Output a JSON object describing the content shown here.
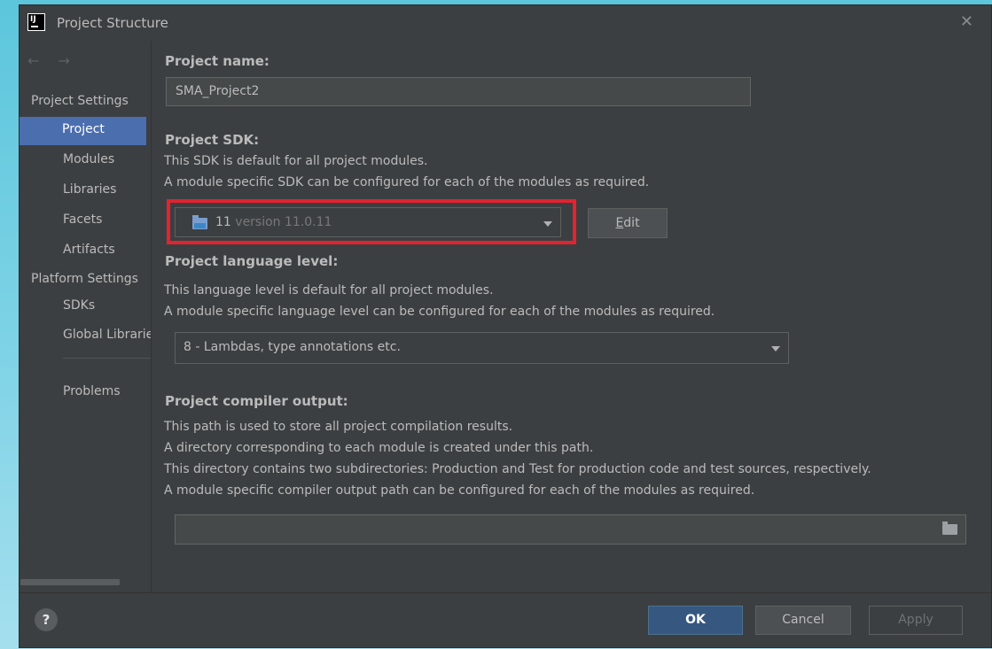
{
  "window": {
    "title": "Project Structure",
    "app_icon_text": "IJ",
    "close_symbol": "✕"
  },
  "sidebar": {
    "nav_arrows": "← →",
    "project_settings_header": "Project Settings",
    "project_items": [
      {
        "label": "Project",
        "selected": true
      },
      {
        "label": "Modules"
      },
      {
        "label": "Libraries"
      },
      {
        "label": "Facets"
      },
      {
        "label": "Artifacts"
      }
    ],
    "platform_settings_header": "Platform Settings",
    "platform_items": [
      {
        "label": "SDKs"
      },
      {
        "label": "Global Libraries"
      }
    ],
    "problems_label": "Problems"
  },
  "main": {
    "project_name": {
      "label": "Project name:",
      "value": "SMA_Project2"
    },
    "project_sdk": {
      "label": "Project SDK:",
      "desc1": "This SDK is default for all project modules.",
      "desc2": "A module specific SDK can be configured for each of the modules as required.",
      "selected_version_prefix": "11",
      "selected_version_suffix": "version 11.0.11",
      "edit_label": "Edit",
      "edit_mnemonic": "E",
      "edit_rest": "dit"
    },
    "language_level": {
      "label": "Project language level:",
      "desc1": "This language level is default for all project modules.",
      "desc2": "A module specific language level can be configured for each of the modules as required.",
      "selected": "8 - Lambdas, type annotations etc."
    },
    "compiler_output": {
      "label": "Project compiler output:",
      "desc1": "This path is used to store all project compilation results.",
      "desc2": "A directory corresponding to each module is created under this path.",
      "desc3": "This directory contains two subdirectories: Production and Test for production code and test sources, respectively.",
      "desc4": "A module specific compiler output path can be configured for each of the modules as required.",
      "value": ""
    }
  },
  "footer": {
    "help_label": "?",
    "ok_label": "OK",
    "cancel_label": "Cancel",
    "apply_label": "Apply"
  },
  "colors": {
    "background_gradient_top": "#5cc6dc",
    "dialog_bg": "#3c3f41",
    "selection": "#4b6eaf",
    "highlight_box": "#e3232f",
    "primary_button": "#365880"
  }
}
